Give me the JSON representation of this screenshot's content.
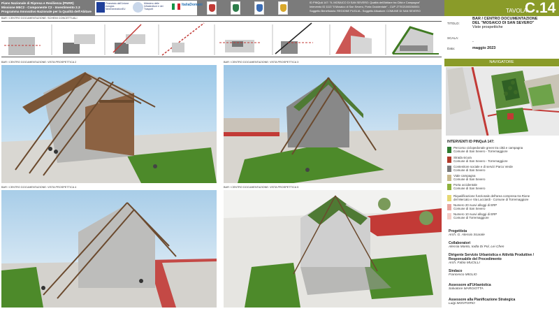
{
  "header": {
    "pnrr_lines": [
      "Piano Nazionale di Ripresa e Resilienza (PNRR)",
      "Missione M5C2 - Componente C2 - Investimento 2.3",
      "Programma Innovativo Nazionale per la Qualità dell'Abitare"
    ],
    "logo_eu_text": "Finanziato dall'Unione europea NextGenerationEU",
    "logo_ministry_text": "Ministero delle Infrastrutture e dei Trasporti",
    "logo_italiadomani": "ItaliaDomani",
    "project_lines": [
      "ID PINQuA 147: \"IL MOSAICO DI SAN SEVERO: Qualità dell'Abitare tra Città e Campagna\"",
      "Intervento ID 1113 \"Il Mosaico di San Severo, Porta Occidentale\" - CUP J77I021000260001",
      "Soggetto Beneficiario: REGIONE PUGLIA  -  Soggetto Attuatore: COMUNE DI SAN SEVERO"
    ],
    "tavola_label": "TAVOLA",
    "tavola_number": "C.14"
  },
  "title_block": {
    "titolo_label": "TITOLO:",
    "titolo_lines": [
      "BAR / CENTRO DOCUMENTAZIONE",
      "DEL \"MOSAICO DI SAN SEVERO\""
    ],
    "subtitle": "Viste prospettiche",
    "scala_label": "SCALA:",
    "scala_value": "-",
    "data_label": "Data:",
    "data_value": "maggio 2023"
  },
  "navigator": {
    "title": "NAVIGATORE"
  },
  "legend": {
    "title": "INTERVENTI ID PINQuA 147:",
    "items": [
      {
        "num": "1",
        "line1": "Percorso ciclopedonale green tra città e campagna",
        "line2": "Comune di San Severo - Torremaggiore",
        "color": "#2e7a2e"
      },
      {
        "num": "2",
        "line1": "Strada sicura",
        "line2": "Comune di San Severo - Torremaggiore",
        "color": "#b13a2a"
      },
      {
        "num": "3",
        "line1": "Contenitore sociale e di servizi Parco Verde",
        "line2": "Comune di San Severo",
        "color": "#7a7a7a"
      },
      {
        "num": "4",
        "line1": "Viale campagna",
        "line2": "Comune di San Severo",
        "color": "#c9b98d"
      },
      {
        "num": "5",
        "line1": "Porta occidentale",
        "line2": "Comune di San Severo",
        "color": "#8fb13c"
      },
      {
        "num": "6",
        "line1": "Riqualificazione funzionale dell'area compresa tra Rione",
        "line2": "del Mercato e Via Lucciardi - Comune di  Torremaggiore",
        "color": "#e6d873"
      },
      {
        "num": "7",
        "line1": "Numero 20 nuovi alloggi di ERP",
        "line2": "Comune di San Severo",
        "color": "#e8a7a0"
      },
      {
        "num": "8",
        "line1": "Numero 10 nuovi alloggi di ERP",
        "line2": "Comune di Torremaggiore",
        "color": "#f3cfc9"
      }
    ]
  },
  "credits": [
    {
      "role": "Progettista",
      "name": "Arch. G. Alessio Scarale"
    },
    {
      "role": "Collaboratori",
      "name": "Alessia Manto, Iodta Di Pol, Lei Chen"
    },
    {
      "role": "Dirigente Servizio Urbanistica e Attività Produttive /",
      "role2": "Responsabile del Procedimento",
      "name": "Arch. Fabio MUCILLI"
    },
    {
      "role": "Sindaco",
      "name": "Francesco MIGLIO"
    },
    {
      "role": "Assessore all'Urbanistica",
      "name": "Salvatore MARGIOTTA"
    },
    {
      "role": "Assessore alla Pianificazione Strategica",
      "name": "Luigi MONTORIO"
    }
  ],
  "schemi": {
    "label": "BAR / CENTRO DOCUMENTAZIONE: SCHEMI CONCETTUALI"
  },
  "views": [
    {
      "label": "BAR / CENTRO DOCUMENTAZIONE: VISTA PROSPETTICA 2"
    },
    {
      "label": "BAR / CENTRO DOCUMENTAZIONE: VISTA PROSPETTICA 3"
    },
    {
      "label": "BAR / CENTRO DOCUMENTAZIONE: VISTA PROSPETTICA 4"
    },
    {
      "label": "BAR / CENTRO DOCUMENTAZIONE: VISTA PROSPETTICA 5"
    }
  ],
  "colors": {
    "accent": "#8a9b29",
    "header_grey": "#7b7b7b",
    "grass": "#4d8a2a",
    "path_red": "#c23a36"
  }
}
